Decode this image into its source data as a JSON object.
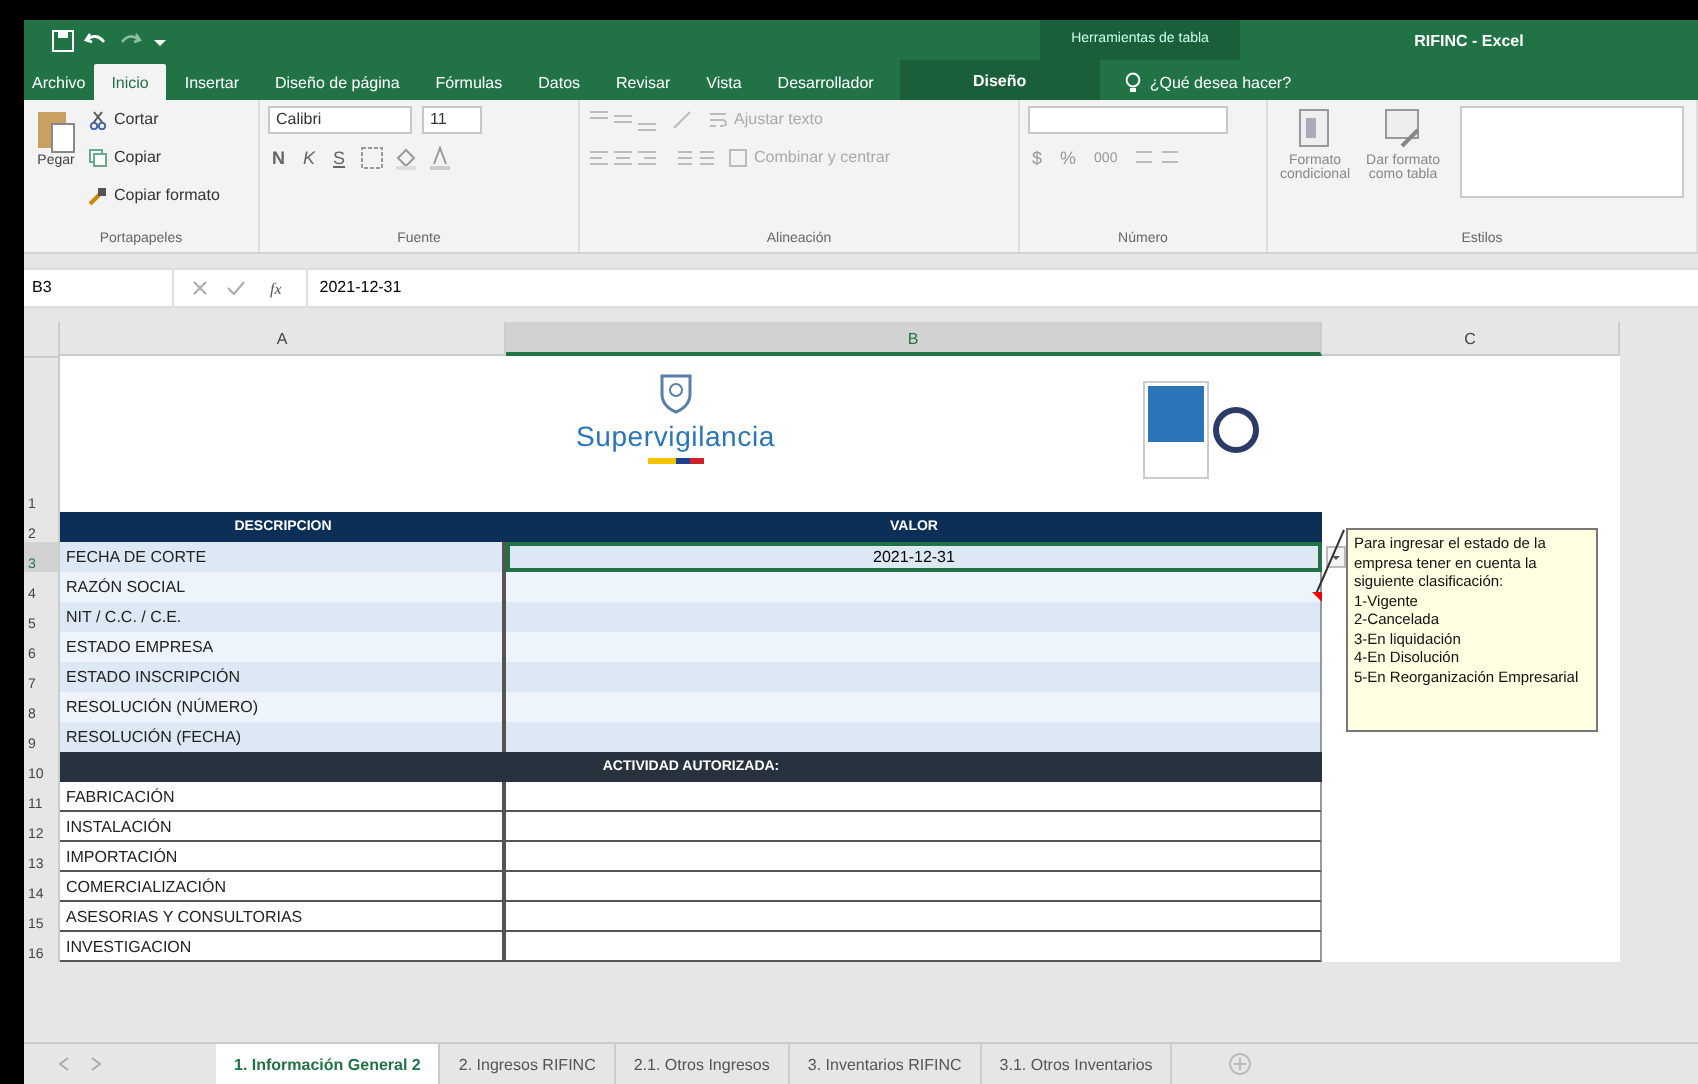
{
  "title_bar": {
    "contextual_label": "Herramientas de tabla",
    "title": "RIFINC - Excel"
  },
  "ribbon_tabs": [
    {
      "label": "Archivo",
      "selected": false,
      "kind": "file"
    },
    {
      "label": "Inicio",
      "selected": true,
      "kind": "normal"
    },
    {
      "label": "Insertar",
      "selected": false,
      "kind": "normal"
    },
    {
      "label": "Diseño de página",
      "selected": false,
      "kind": "normal"
    },
    {
      "label": "Fórmulas",
      "selected": false,
      "kind": "normal"
    },
    {
      "label": "Datos",
      "selected": false,
      "kind": "normal"
    },
    {
      "label": "Revisar",
      "selected": false,
      "kind": "normal"
    },
    {
      "label": "Vista",
      "selected": false,
      "kind": "normal"
    },
    {
      "label": "Desarrollador",
      "selected": false,
      "kind": "normal"
    },
    {
      "label": "Diseño",
      "selected": false,
      "kind": "contextual"
    }
  ],
  "tell_me": "¿Qué desea hacer?",
  "ribbon": {
    "clipboard": {
      "paste": "Pegar",
      "cut": "Cortar",
      "copy": "Copiar",
      "format_painter": "Copiar formato",
      "group": "Portapapeles"
    },
    "font": {
      "font_name": "Calibri",
      "font_size": "11",
      "bold": "N",
      "italic": "K",
      "underline": "S",
      "group": "Fuente"
    },
    "alignment": {
      "wrap_text": "Ajustar texto",
      "merge": "Combinar y centrar",
      "group": "Alineación"
    },
    "number": {
      "currency": "$",
      "percent": "%",
      "thousands": "000",
      "group": "Número"
    },
    "styles": {
      "conditional": [
        "Formato",
        "condicional"
      ],
      "as_table": [
        "Dar formato",
        "como tabla"
      ],
      "group": "Estilos"
    }
  },
  "formula_bar": {
    "name_box": "B3",
    "fx": "fx",
    "formula": "2021-12-31"
  },
  "columns": [
    {
      "label": "A",
      "selected": false
    },
    {
      "label": "B",
      "selected": true
    },
    {
      "label": "C",
      "selected": false
    }
  ],
  "logo": {
    "name": "Supervigilancia"
  },
  "rows": [
    {
      "number": "1",
      "kind": "logo",
      "selected": false
    },
    {
      "number": "2",
      "kind": "header",
      "label": "DESCRIPCION",
      "value": "VALOR",
      "selected": false
    },
    {
      "number": "3",
      "kind": "data",
      "label": "FECHA DE CORTE",
      "value": "2021-12-31",
      "selected": true
    },
    {
      "number": "4",
      "kind": "data",
      "label": "RAZÓN SOCIAL",
      "value": "",
      "selected": false
    },
    {
      "number": "5",
      "kind": "data",
      "label": "NIT / C.C. / C.E.",
      "value": "",
      "selected": false
    },
    {
      "number": "6",
      "kind": "data",
      "label": "ESTADO EMPRESA",
      "value": "",
      "selected": false
    },
    {
      "number": "7",
      "kind": "data",
      "label": "ESTADO INSCRIPCIÓN",
      "value": "",
      "selected": false
    },
    {
      "number": "8",
      "kind": "data",
      "label": "RESOLUCIÓN (NÚMERO)",
      "value": "",
      "selected": false
    },
    {
      "number": "9",
      "kind": "data",
      "label": "RESOLUCIÓN (FECHA)",
      "value": "",
      "selected": false
    },
    {
      "number": "10",
      "kind": "section",
      "label": "ACTIVIDAD AUTORIZADA:",
      "selected": false
    },
    {
      "number": "11",
      "kind": "plain",
      "label": "FABRICACIÓN",
      "value": "",
      "selected": false
    },
    {
      "number": "12",
      "kind": "plain",
      "label": "INSTALACIÓN",
      "value": "",
      "selected": false
    },
    {
      "number": "13",
      "kind": "plain",
      "label": "IMPORTACIÓN",
      "value": "",
      "selected": false
    },
    {
      "number": "14",
      "kind": "plain",
      "label": "COMERCIALIZACIÓN",
      "value": "",
      "selected": false
    },
    {
      "number": "15",
      "kind": "plain",
      "label": "ASESORIAS Y CONSULTORIAS",
      "value": "",
      "selected": false
    },
    {
      "number": "16",
      "kind": "plain",
      "label": "INVESTIGACION",
      "value": "",
      "selected": false
    }
  ],
  "comment": {
    "text": "Para ingresar el estado de la empresa tener en cuenta la siguiente clasificación:",
    "items": [
      "1-Vigente",
      "2-Cancelada",
      "3-En liquidación",
      "4-En Disolución",
      "5-En Reorganización Empresarial"
    ]
  },
  "sheet_tabs": [
    {
      "label": "1. Información General 2",
      "selected": true
    },
    {
      "label": "2. Ingresos RIFINC",
      "selected": false
    },
    {
      "label": "2.1. Otros Ingresos",
      "selected": false
    },
    {
      "label": "3. Inventarios RIFINC",
      "selected": false
    },
    {
      "label": "3.1. Otros Inventarios",
      "selected": false
    }
  ]
}
